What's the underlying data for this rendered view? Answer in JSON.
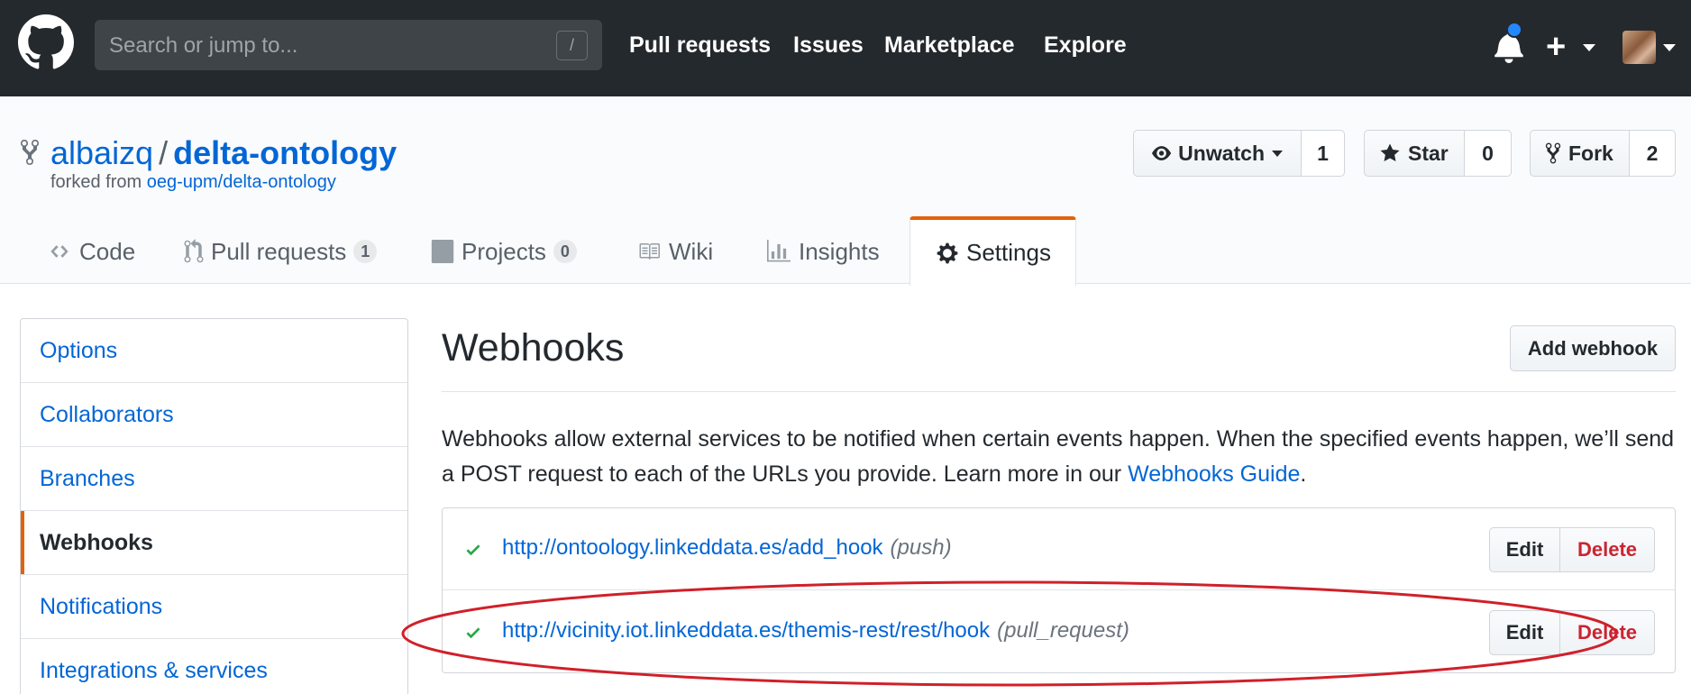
{
  "header": {
    "search_placeholder": "Search or jump to...",
    "search_shortcut": "/",
    "nav": [
      "Pull requests",
      "Issues",
      "Marketplace",
      "Explore"
    ],
    "plus_label": "+",
    "notification_dot_color": "#2188ff"
  },
  "repo": {
    "owner": "albaizq",
    "separator": "/",
    "name": "delta-ontology",
    "forked_prefix": "forked from",
    "forked_source": "oeg-upm/delta-ontology",
    "unwatch_label": "Unwatch",
    "watch_count": "1",
    "star_label": "Star",
    "star_count": "0",
    "fork_label": "Fork",
    "fork_count": "2"
  },
  "tabs": {
    "code": "Code",
    "pull_requests": "Pull requests",
    "pull_requests_count": "1",
    "projects": "Projects",
    "projects_count": "0",
    "wiki": "Wiki",
    "insights": "Insights",
    "settings": "Settings",
    "selected_accent": "#e36209"
  },
  "sidebar": {
    "items": [
      "Options",
      "Collaborators",
      "Branches",
      "Webhooks",
      "Notifications",
      "Integrations & services"
    ],
    "selected": "Webhooks"
  },
  "main": {
    "title": "Webhooks",
    "add_button": "Add webhook",
    "description_text": "Webhooks allow external services to be notified when certain events happen. When the specified events happen, we’ll send a POST request to each of the URLs you provide. Learn more in our ",
    "description_link": "Webhooks Guide",
    "description_end": ".",
    "hooks": [
      {
        "url": "http://ontoology.linkeddata.es/add_hook",
        "event": "(push)",
        "status": "active"
      },
      {
        "url": "http://vicinity.iot.linkeddata.es/themis-rest/rest/hook",
        "event": "(pull_request)",
        "status": "active"
      }
    ],
    "edit_label": "Edit",
    "delete_label": "Delete",
    "annotation_color": "#d0202a"
  }
}
